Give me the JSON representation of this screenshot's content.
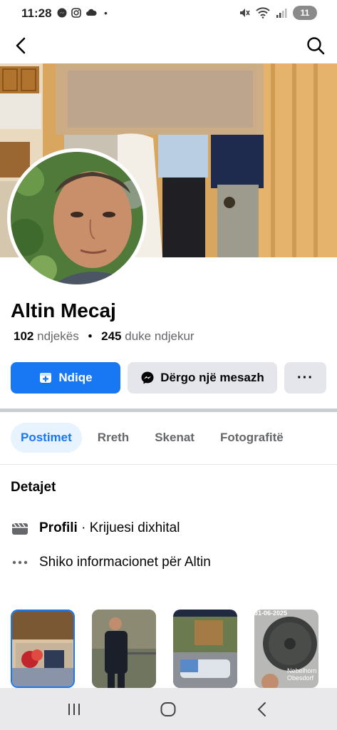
{
  "status_bar": {
    "time": "11:28",
    "dot": "•",
    "battery": "11"
  },
  "profile": {
    "name": "Altin Mecaj",
    "followers_count": "102",
    "followers_label": "ndjekës",
    "separator": "•",
    "following_count": "245",
    "following_label": "duke ndjekur"
  },
  "actions": {
    "follow_label": "Ndiqe",
    "message_label": "Dërgo një mesazh",
    "more_label": "···"
  },
  "tabs": [
    {
      "label": "Postimet",
      "active": true
    },
    {
      "label": "Rreth",
      "active": false
    },
    {
      "label": "Skenat",
      "active": false
    },
    {
      "label": "Fotografitë",
      "active": false
    }
  ],
  "details": {
    "title": "Detajet",
    "profile_bold": "Profili",
    "profile_rest": " · Krijuesi dixhital",
    "see_info": "Shiko informacionet për Altin"
  },
  "photo_overlays": {
    "date_text": "31-06-2025",
    "place_line1": "Nebelhorn",
    "place_line2": "Obesdorf"
  },
  "colors": {
    "accent": "#1877f2",
    "button_gray": "#e4e6eb",
    "tab_active_bg": "#e7f3ff"
  }
}
